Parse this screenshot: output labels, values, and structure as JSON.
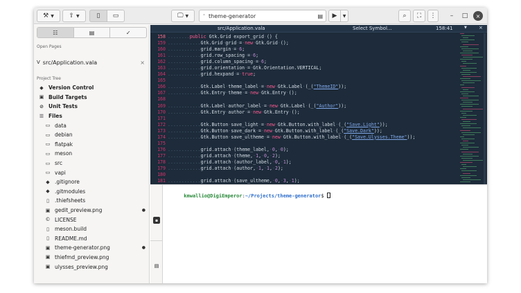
{
  "headerbar": {
    "search_label": "theme-generator",
    "window_buttons": {
      "minimize": "–",
      "maximize": "□",
      "close": "×"
    }
  },
  "sidebar": {
    "open_pages_title": "Open Pages",
    "open_page": "src/Application.vala",
    "project_tree_title": "Project Tree",
    "top_items": [
      "Version Control",
      "Build Targets",
      "Unit Tests",
      "Files"
    ],
    "files": [
      {
        "name": "data",
        "icon": "folder-icon",
        "mark": ""
      },
      {
        "name": "debian",
        "icon": "folder-icon",
        "mark": ""
      },
      {
        "name": "flatpak",
        "icon": "folder-icon",
        "mark": ""
      },
      {
        "name": "meson",
        "icon": "folder-icon",
        "mark": ""
      },
      {
        "name": "src",
        "icon": "folder-icon",
        "mark": ""
      },
      {
        "name": "vapi",
        "icon": "folder-icon",
        "mark": ""
      },
      {
        "name": ".gitignore",
        "icon": "git-icon",
        "mark": ""
      },
      {
        "name": ".gitmodules",
        "icon": "git-icon",
        "mark": ""
      },
      {
        "name": ".thiefsheets",
        "icon": "file-icon",
        "mark": ""
      },
      {
        "name": "gedit_preview.png",
        "icon": "image-icon",
        "mark": "●"
      },
      {
        "name": "LICENSE",
        "icon": "license-icon",
        "mark": ""
      },
      {
        "name": "meson.build",
        "icon": "file-icon",
        "mark": ""
      },
      {
        "name": "README.md",
        "icon": "file-icon",
        "mark": ""
      },
      {
        "name": "theme-generator.png",
        "icon": "image-icon",
        "mark": "●"
      },
      {
        "name": "thiefmd_preview.png",
        "icon": "image-icon",
        "mark": ""
      },
      {
        "name": "ulysses_preview.png",
        "icon": "image-icon",
        "mark": ""
      }
    ]
  },
  "editor": {
    "filename": "src/Application.vala",
    "symbol_selector": "Select Symbol…",
    "cursor_position": "158:41",
    "lines": [
      {
        "n": "158",
        "segs": [
          [
            "ws",
            "........"
          ],
          [
            "kw",
            "public"
          ],
          [
            "tx",
            " Gtk.Grid "
          ],
          [
            "tx",
            "export_grid"
          ],
          [
            "ws",
            "·"
          ],
          [
            "tx",
            "() {"
          ]
        ]
      },
      {
        "n": "159",
        "segs": [
          [
            "ws",
            "............"
          ],
          [
            "tx",
            "Gtk.Grid"
          ],
          [
            "ws",
            "·"
          ],
          [
            "tx",
            "grid"
          ],
          [
            "ws",
            "·"
          ],
          [
            "tx",
            "="
          ],
          [
            "ws",
            "·"
          ],
          [
            "kw",
            "new"
          ],
          [
            "ws",
            "·"
          ],
          [
            "tx",
            "Gtk.Grid"
          ],
          [
            "ws",
            "·"
          ],
          [
            "tx",
            "();"
          ]
        ]
      },
      {
        "n": "160",
        "segs": [
          [
            "ws",
            "............"
          ],
          [
            "tx",
            "grid.margin"
          ],
          [
            "ws",
            "·"
          ],
          [
            "tx",
            "="
          ],
          [
            "ws",
            "·"
          ],
          [
            "num",
            "6"
          ],
          [
            "tx",
            ";"
          ]
        ]
      },
      {
        "n": "161",
        "segs": [
          [
            "ws",
            "............"
          ],
          [
            "tx",
            "grid.row_spacing"
          ],
          [
            "ws",
            "·"
          ],
          [
            "tx",
            "="
          ],
          [
            "ws",
            "·"
          ],
          [
            "num",
            "6"
          ],
          [
            "tx",
            ";"
          ]
        ]
      },
      {
        "n": "162",
        "segs": [
          [
            "ws",
            "............"
          ],
          [
            "tx",
            "grid.column_spacing"
          ],
          [
            "ws",
            "·"
          ],
          [
            "tx",
            "="
          ],
          [
            "ws",
            "·"
          ],
          [
            "num",
            "6"
          ],
          [
            "tx",
            ";"
          ]
        ]
      },
      {
        "n": "163",
        "segs": [
          [
            "ws",
            "............"
          ],
          [
            "tx",
            "grid.orientation"
          ],
          [
            "ws",
            "·"
          ],
          [
            "tx",
            "="
          ],
          [
            "ws",
            "·"
          ],
          [
            "tx",
            "Gtk.Orientation.VERTICAL;"
          ]
        ]
      },
      {
        "n": "164",
        "segs": [
          [
            "ws",
            "............"
          ],
          [
            "tx",
            "grid.hexpand"
          ],
          [
            "ws",
            "·"
          ],
          [
            "tx",
            "="
          ],
          [
            "ws",
            "·"
          ],
          [
            "kw",
            "true"
          ],
          [
            "tx",
            ";"
          ]
        ]
      },
      {
        "n": "165",
        "segs": []
      },
      {
        "n": "166",
        "segs": [
          [
            "ws",
            "............"
          ],
          [
            "tx",
            "Gtk.Label"
          ],
          [
            "ws",
            "·"
          ],
          [
            "tx",
            "theme_label"
          ],
          [
            "ws",
            "·"
          ],
          [
            "tx",
            "="
          ],
          [
            "ws",
            "·"
          ],
          [
            "kw",
            "new"
          ],
          [
            "ws",
            "·"
          ],
          [
            "tx",
            "Gtk.Label"
          ],
          [
            "ws",
            "·"
          ],
          [
            "tx",
            "(_("
          ],
          [
            "str",
            "\"ThemeID\""
          ],
          [
            "tx",
            "));"
          ]
        ]
      },
      {
        "n": "167",
        "segs": [
          [
            "ws",
            "............"
          ],
          [
            "tx",
            "Gtk.Entry"
          ],
          [
            "ws",
            "·"
          ],
          [
            "tx",
            "theme"
          ],
          [
            "ws",
            "·"
          ],
          [
            "tx",
            "="
          ],
          [
            "ws",
            "·"
          ],
          [
            "kw",
            "new"
          ],
          [
            "ws",
            "·"
          ],
          [
            "tx",
            "Gtk.Entry"
          ],
          [
            "ws",
            "·"
          ],
          [
            "tx",
            "();"
          ]
        ]
      },
      {
        "n": "168",
        "segs": []
      },
      {
        "n": "169",
        "segs": [
          [
            "ws",
            "............"
          ],
          [
            "tx",
            "Gtk.Label"
          ],
          [
            "ws",
            "·"
          ],
          [
            "tx",
            "author_label"
          ],
          [
            "ws",
            "·"
          ],
          [
            "tx",
            "="
          ],
          [
            "ws",
            "·"
          ],
          [
            "kw",
            "new"
          ],
          [
            "ws",
            "·"
          ],
          [
            "tx",
            "Gtk.Label"
          ],
          [
            "ws",
            "·"
          ],
          [
            "tx",
            "(_("
          ],
          [
            "str",
            "\"Author\""
          ],
          [
            "tx",
            "));"
          ]
        ]
      },
      {
        "n": "170",
        "segs": [
          [
            "ws",
            "............"
          ],
          [
            "tx",
            "Gtk.Entry"
          ],
          [
            "ws",
            "·"
          ],
          [
            "tx",
            "author"
          ],
          [
            "ws",
            "·"
          ],
          [
            "tx",
            "="
          ],
          [
            "ws",
            "·"
          ],
          [
            "kw",
            "new"
          ],
          [
            "ws",
            "·"
          ],
          [
            "tx",
            "Gtk.Entry"
          ],
          [
            "ws",
            "·"
          ],
          [
            "tx",
            "();"
          ]
        ]
      },
      {
        "n": "171",
        "segs": []
      },
      {
        "n": "172",
        "segs": [
          [
            "ws",
            "............"
          ],
          [
            "tx",
            "Gtk.Button"
          ],
          [
            "ws",
            "·"
          ],
          [
            "tx",
            "save_light"
          ],
          [
            "ws",
            "·"
          ],
          [
            "tx",
            "="
          ],
          [
            "ws",
            "·"
          ],
          [
            "kw",
            "new"
          ],
          [
            "ws",
            "·"
          ],
          [
            "tx",
            "Gtk.Button.with_label"
          ],
          [
            "ws",
            "·"
          ],
          [
            "tx",
            "(_("
          ],
          [
            "str",
            "\"Save.Light\""
          ],
          [
            "tx",
            "));"
          ]
        ]
      },
      {
        "n": "173",
        "segs": [
          [
            "ws",
            "............"
          ],
          [
            "tx",
            "Gtk.Button"
          ],
          [
            "ws",
            "·"
          ],
          [
            "tx",
            "save_dark"
          ],
          [
            "ws",
            "·"
          ],
          [
            "tx",
            "="
          ],
          [
            "ws",
            "·"
          ],
          [
            "kw",
            "new"
          ],
          [
            "ws",
            "·"
          ],
          [
            "tx",
            "Gtk.Button.with_label"
          ],
          [
            "ws",
            "·"
          ],
          [
            "tx",
            "(_("
          ],
          [
            "str",
            "\"Save.Dark\""
          ],
          [
            "tx",
            "));"
          ]
        ]
      },
      {
        "n": "174",
        "segs": [
          [
            "ws",
            "............"
          ],
          [
            "tx",
            "Gtk.Button"
          ],
          [
            "ws",
            "·"
          ],
          [
            "tx",
            "save_ultheme"
          ],
          [
            "ws",
            "·"
          ],
          [
            "tx",
            "="
          ],
          [
            "ws",
            "·"
          ],
          [
            "kw",
            "new"
          ],
          [
            "ws",
            "·"
          ],
          [
            "tx",
            "Gtk.Button.with_label"
          ],
          [
            "ws",
            "·"
          ],
          [
            "tx",
            "(_("
          ],
          [
            "str",
            "\"Save.Ulysses.Theme\""
          ],
          [
            "tx",
            "));"
          ]
        ]
      },
      {
        "n": "175",
        "segs": []
      },
      {
        "n": "176",
        "segs": [
          [
            "ws",
            "............"
          ],
          [
            "tx",
            "grid.attach"
          ],
          [
            "ws",
            "·"
          ],
          [
            "tx",
            "(theme_label,"
          ],
          [
            "ws",
            "·"
          ],
          [
            "num",
            "0"
          ],
          [
            "tx",
            ","
          ],
          [
            "ws",
            "·"
          ],
          [
            "num",
            "0"
          ],
          [
            "tx",
            ");"
          ]
        ]
      },
      {
        "n": "177",
        "segs": [
          [
            "ws",
            "............"
          ],
          [
            "tx",
            "grid.attach"
          ],
          [
            "ws",
            "·"
          ],
          [
            "tx",
            "(theme,"
          ],
          [
            "ws",
            "·"
          ],
          [
            "num",
            "1"
          ],
          [
            "tx",
            ","
          ],
          [
            "ws",
            "·"
          ],
          [
            "num",
            "0"
          ],
          [
            "tx",
            ","
          ],
          [
            "ws",
            "·"
          ],
          [
            "num",
            "2"
          ],
          [
            "tx",
            ");"
          ]
        ]
      },
      {
        "n": "178",
        "segs": [
          [
            "ws",
            "............"
          ],
          [
            "tx",
            "grid.attach"
          ],
          [
            "ws",
            "·"
          ],
          [
            "tx",
            "(author_label,"
          ],
          [
            "ws",
            "·"
          ],
          [
            "num",
            "0"
          ],
          [
            "tx",
            ","
          ],
          [
            "ws",
            "·"
          ],
          [
            "num",
            "1"
          ],
          [
            "tx",
            ");"
          ]
        ]
      },
      {
        "n": "179",
        "segs": [
          [
            "ws",
            "............"
          ],
          [
            "tx",
            "grid.attach"
          ],
          [
            "ws",
            "·"
          ],
          [
            "tx",
            "(author,"
          ],
          [
            "ws",
            "·"
          ],
          [
            "num",
            "1"
          ],
          [
            "tx",
            ","
          ],
          [
            "ws",
            "·"
          ],
          [
            "num",
            "1"
          ],
          [
            "tx",
            ","
          ],
          [
            "ws",
            "·"
          ],
          [
            "num",
            "2"
          ],
          [
            "tx",
            ");"
          ]
        ]
      },
      {
        "n": "180",
        "segs": []
      },
      {
        "n": "181",
        "segs": [
          [
            "ws",
            "............"
          ],
          [
            "tx",
            "grid.attach"
          ],
          [
            "ws",
            "·"
          ],
          [
            "tx",
            "(save_ultheme,"
          ],
          [
            "ws",
            "·"
          ],
          [
            "num",
            "0"
          ],
          [
            "tx",
            ","
          ],
          [
            "ws",
            "·"
          ],
          [
            "num",
            "3"
          ],
          [
            "tx",
            ","
          ],
          [
            "ws",
            "·"
          ],
          [
            "num",
            "1"
          ],
          [
            "tx",
            ");"
          ]
        ]
      }
    ]
  },
  "terminal": {
    "user": "kmwallio@DigiEmperor",
    "path": "~/Projects/theme-generator",
    "prompt_suffix": "$ "
  },
  "colors": {
    "editor_bg": "#1d2b3a",
    "line_number": "#d6336c",
    "keyword": "#ff5c93",
    "string": "#7fa7e8",
    "terminal_user": "#2a8a3a",
    "terminal_path": "#2f6fcc"
  }
}
